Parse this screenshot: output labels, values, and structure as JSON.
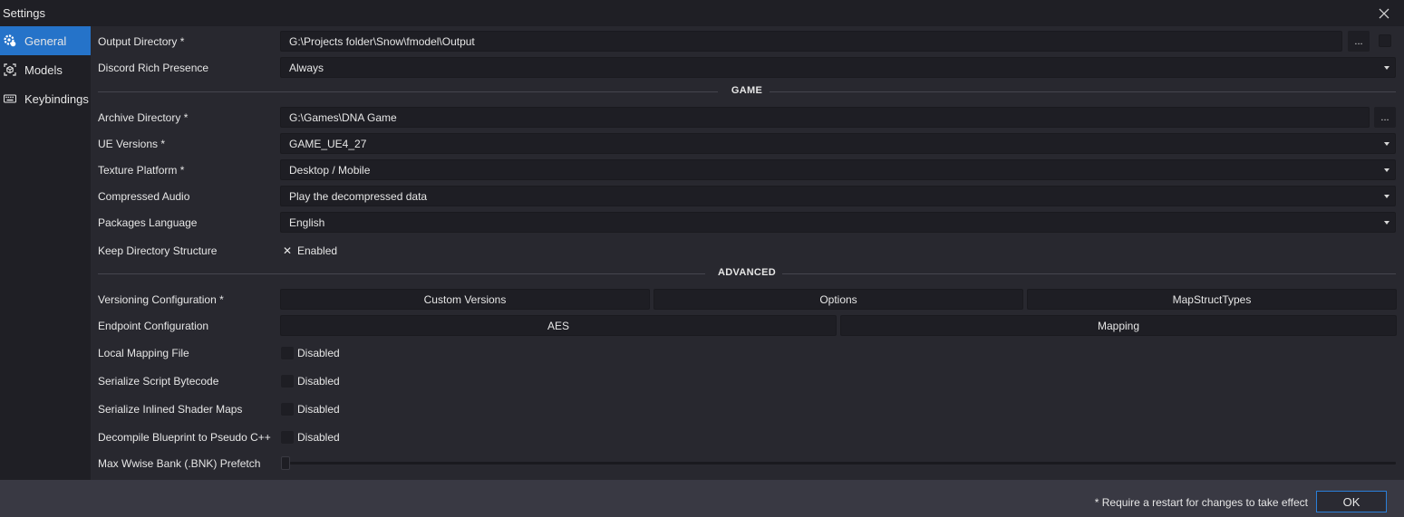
{
  "window": {
    "title": "Settings"
  },
  "sidebar": {
    "items": [
      {
        "label": "General",
        "icon": "gear-icon",
        "active": true
      },
      {
        "label": "Models",
        "icon": "cube-icon",
        "active": false
      },
      {
        "label": "Keybindings",
        "icon": "keyboard-icon",
        "active": false
      }
    ]
  },
  "general": {
    "output_directory": {
      "label": "Output Directory *",
      "value": "G:\\Projects folder\\Snow\\fmodel\\Output",
      "browse": "..."
    },
    "discord_rich_presence": {
      "label": "Discord Rich Presence",
      "value": "Always"
    }
  },
  "game": {
    "header": "GAME",
    "archive_directory": {
      "label": "Archive Directory *",
      "value": "G:\\Games\\DNA Game",
      "browse": "..."
    },
    "ue_versions": {
      "label": "UE Versions *",
      "value": "GAME_UE4_27"
    },
    "texture_platform": {
      "label": "Texture Platform *",
      "value": "Desktop / Mobile"
    },
    "compressed_audio": {
      "label": "Compressed Audio",
      "value": "Play the decompressed data"
    },
    "packages_language": {
      "label": "Packages Language",
      "value": "English"
    },
    "keep_directory_structure": {
      "label": "Keep Directory Structure",
      "state": "Enabled",
      "mark": "✕"
    }
  },
  "advanced": {
    "header": "ADVANCED",
    "versioning": {
      "label": "Versioning Configuration *",
      "buttons": [
        "Custom Versions",
        "Options",
        "MapStructTypes"
      ]
    },
    "endpoint": {
      "label": "Endpoint Configuration",
      "buttons": [
        "AES",
        "Mapping"
      ]
    },
    "local_mapping_file": {
      "label": "Local Mapping File",
      "state": "Disabled"
    },
    "serialize_script_bytecode": {
      "label": "Serialize Script Bytecode",
      "state": "Disabled"
    },
    "serialize_inlined_shader_maps": {
      "label": "Serialize Inlined Shader Maps",
      "state": "Disabled"
    },
    "decompile_blueprint": {
      "label": "Decompile Blueprint to Pseudo C++",
      "state": "Disabled"
    },
    "max_wwise_bank": {
      "label": "Max Wwise Bank (.BNK) Prefetch",
      "value": 0
    }
  },
  "footer": {
    "note": "* Require a restart for changes to take effect",
    "ok": "OK"
  },
  "colors": {
    "accent": "#2573c9",
    "background": "#28282f",
    "footer": "#393943"
  }
}
